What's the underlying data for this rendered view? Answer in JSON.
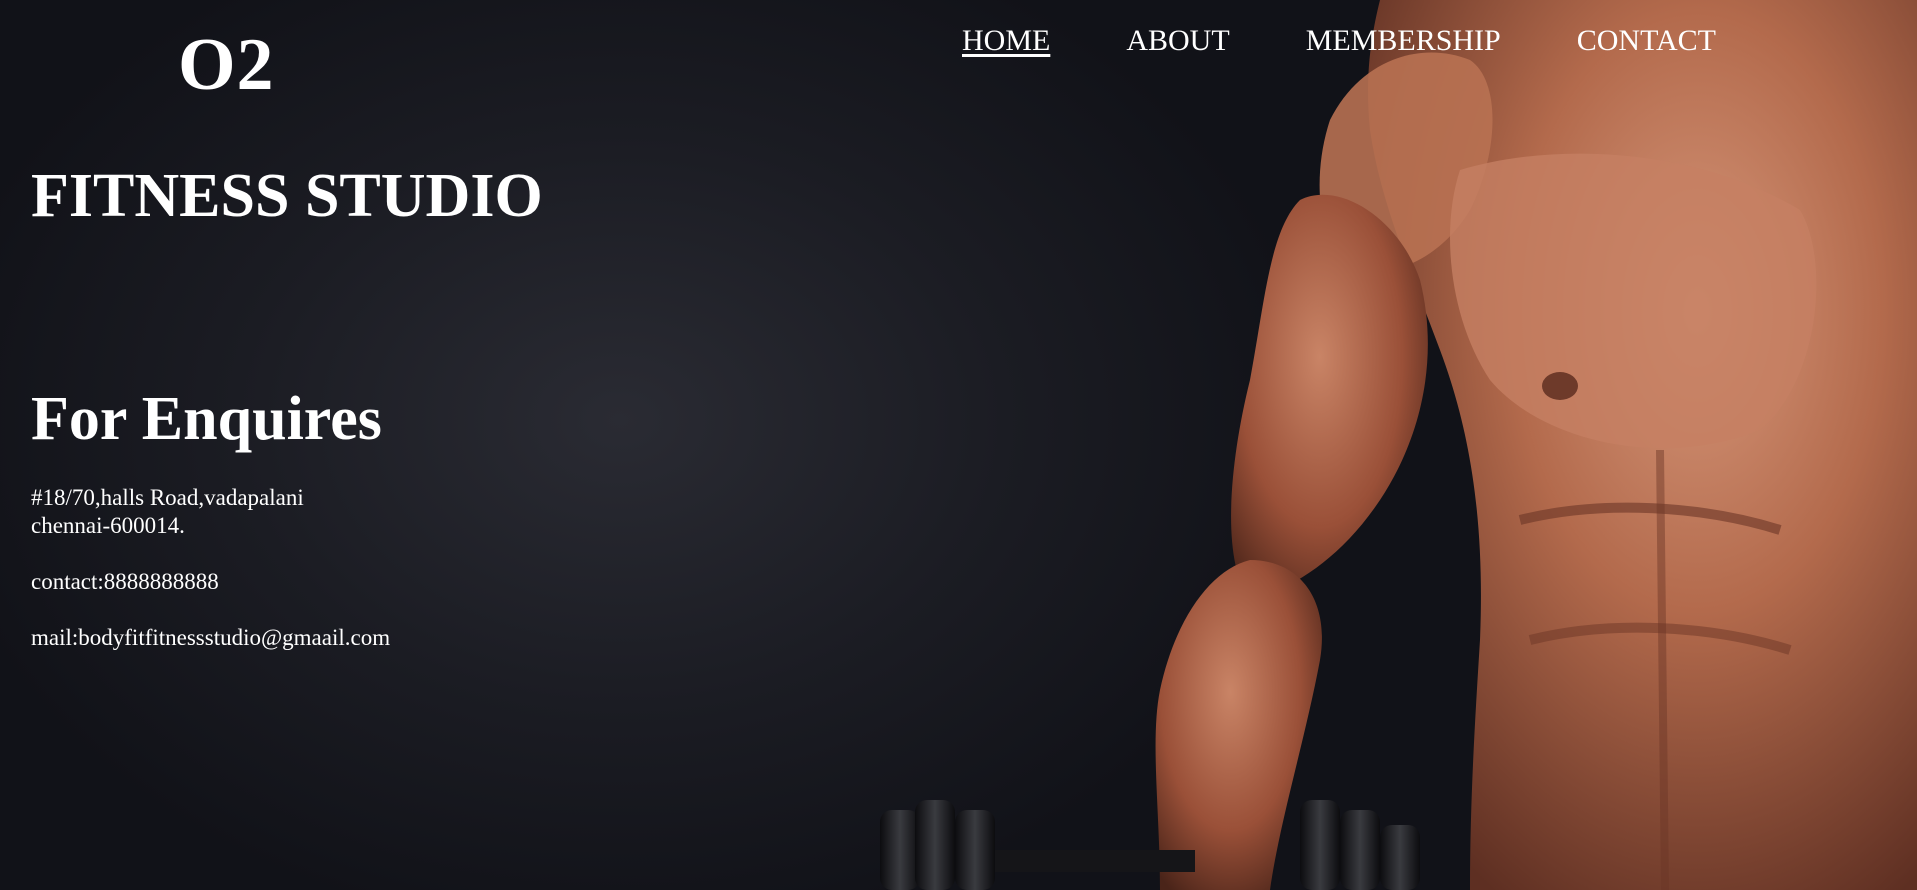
{
  "brand": {
    "logo": "O2",
    "subtitle": "FITNESS STUDIO"
  },
  "nav": {
    "items": [
      {
        "label": "HOME",
        "active": true
      },
      {
        "label": "ABOUT",
        "active": false
      },
      {
        "label": "MEMBERSHIP",
        "active": false
      },
      {
        "label": "CONTACT",
        "active": false
      }
    ]
  },
  "enquiry": {
    "title": "For Enquires",
    "address_line1": "#18/70,halls Road,vadapalani",
    "address_line2": "chennai-600014.",
    "contact": "contact:8888888888",
    "mail": "mail:bodyfitfitnessstudio@gmaail.com"
  },
  "colors": {
    "text": "#ffffff",
    "background": "#1b1c23",
    "skin": "#b0674a"
  },
  "background_image": "muscular-man-holding-dumbbell-photo"
}
